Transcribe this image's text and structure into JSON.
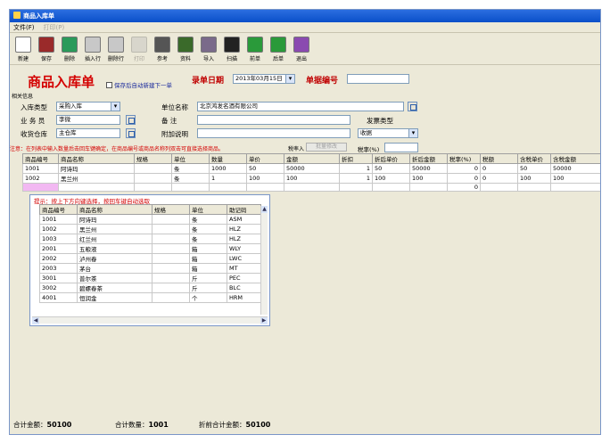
{
  "window": {
    "title": "商品入库单"
  },
  "menu": [
    "文件(F)",
    "打印(P)"
  ],
  "toolbar": [
    {
      "label": "新建",
      "icon": "new-doc-icon",
      "color": "#ffffff",
      "disabled": false
    },
    {
      "label": "保存",
      "icon": "floppy-icon",
      "color": "#9a2a2a",
      "disabled": false
    },
    {
      "label": "删除",
      "icon": "recycle-icon",
      "color": "#2a9a5a",
      "disabled": false
    },
    {
      "label": "插入行",
      "icon": "insert-row-icon",
      "color": "#c8c8c8",
      "disabled": false
    },
    {
      "label": "删除行",
      "icon": "delete-row-icon",
      "color": "#c8c8c8",
      "disabled": false
    },
    {
      "label": "打印",
      "icon": "print-icon",
      "color": "#bbbbbb",
      "disabled": true
    },
    {
      "label": "参考",
      "icon": "reference-icon",
      "color": "#555555",
      "disabled": false
    },
    {
      "label": "资料",
      "icon": "data-book-icon",
      "color": "#3a6a2a",
      "disabled": false
    },
    {
      "label": "导入",
      "icon": "import-gear-icon",
      "color": "#7a6a8a",
      "disabled": false
    },
    {
      "label": "扫描",
      "icon": "barcode-icon",
      "color": "#222222",
      "disabled": false
    },
    {
      "label": "前单",
      "icon": "arrow-left-icon",
      "color": "#2a9a3a",
      "disabled": false
    },
    {
      "label": "后单",
      "icon": "arrow-right-icon",
      "color": "#2a9a3a",
      "disabled": false
    },
    {
      "label": "退出",
      "icon": "exit-icon",
      "color": "#8a4ab0",
      "disabled": false
    }
  ],
  "form": {
    "title": "商品入库单",
    "auto_new_label": "保存后自动新建下一单",
    "date_label": "录单日期",
    "date_value": "2013年03月15日",
    "docno_label": "单据编号",
    "docno_value": "",
    "section_label": "相关信息",
    "type_label": "入库类型",
    "type_value": "采购入库",
    "company_label": "单位名称",
    "company_value": "北京鸿发名酒有限公司",
    "clerk_label": "业 务 员",
    "clerk_value": "李微",
    "remark_label": "备    注",
    "remark_value": "",
    "invoice_label": "发票类型",
    "warehouse_label": "收货仓库",
    "warehouse_value": "主仓库",
    "extra_label": "附加说明",
    "extra_value": "",
    "invoice_value": "收据",
    "notice": "注意：在列表中输入数量后击回车键确定，在商品编号或商品名称列双击可直接选择商品。",
    "tax_rate_head": "税率入",
    "tax_btn": "批量修改",
    "tax_rate_label": "税率(%)",
    "tax_rate_value": ""
  },
  "grid": {
    "headers": [
      "商品编号",
      "商品名称",
      "规格",
      "单位",
      "数量",
      "单价",
      "金额",
      "折扣",
      "折后单价",
      "折后金额",
      "税率(%)",
      "税额",
      "含税单价",
      "含税金额"
    ],
    "rows": [
      [
        "1001",
        "阿诗玛",
        "",
        "条",
        "1000",
        "50",
        "50000",
        "1",
        "50",
        "50000",
        "0",
        "0",
        "50",
        "50000"
      ],
      [
        "1002",
        "黑兰州",
        "",
        "条",
        "1",
        "100",
        "100",
        "1",
        "100",
        "100",
        "0",
        "0",
        "100",
        "100"
      ],
      [
        "",
        "",
        "",
        "",
        "",
        "",
        "",
        "",
        "",
        "",
        "0",
        "",
        "",
        ""
      ]
    ]
  },
  "popup": {
    "hint": "提示：按上下方向键选择，按回车键自动选取",
    "headers": [
      "商品编号",
      "商品名称",
      "规格",
      "单位",
      "助记码"
    ],
    "rows": [
      [
        "1001",
        "阿诗玛",
        "",
        "条",
        "ASM"
      ],
      [
        "1002",
        "黑兰州",
        "",
        "条",
        "HLZ"
      ],
      [
        "1003",
        "红兰州",
        "",
        "条",
        "HLZ"
      ],
      [
        "2001",
        "五粮液",
        "",
        "箱",
        "WLY"
      ],
      [
        "2002",
        "泸州春",
        "",
        "箱",
        "LWC"
      ],
      [
        "2003",
        "茅台",
        "",
        "箱",
        "MT"
      ],
      [
        "3001",
        "普尔茶",
        "",
        "斤",
        "PEC"
      ],
      [
        "3002",
        "碧螺春茶",
        "",
        "斤",
        "BLC"
      ],
      [
        "4001",
        "恒润金",
        "",
        "个",
        "HRM"
      ]
    ]
  },
  "footer": {
    "total_amount_label": "合计金额：",
    "total_amount": "50100",
    "total_qty_label": "合计数量：",
    "total_qty": "1001",
    "discount_total_label": "折前合计金额：",
    "discount_total": "50100"
  }
}
